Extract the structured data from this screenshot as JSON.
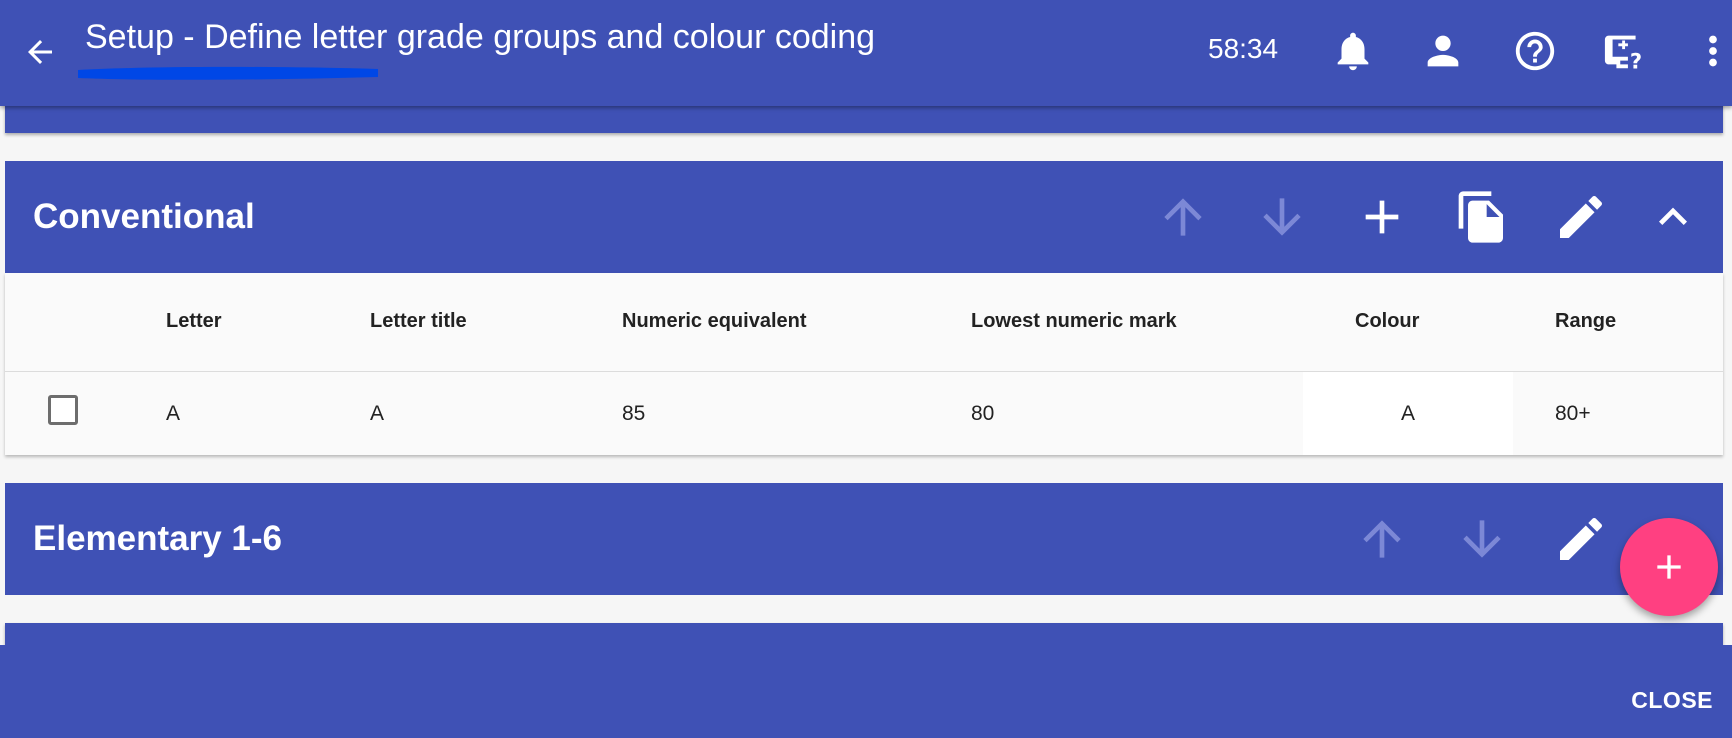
{
  "app_bar": {
    "title": "Setup - Define letter grade groups and colour coding",
    "timer": "58:34",
    "icons": [
      "back-arrow-icon",
      "bell-icon",
      "person-icon",
      "help-circle-icon",
      "monitor-help-icon",
      "more-vert-icon"
    ],
    "accent_color": "#3f51b5"
  },
  "groups": [
    {
      "name": "Conventional",
      "actions": [
        "move-up",
        "move-down",
        "add",
        "copy",
        "edit",
        "collapse"
      ],
      "table": {
        "columns": [
          "Letter",
          "Letter title",
          "Numeric equivalent",
          "Lowest numeric mark",
          "Colour",
          "Range"
        ],
        "rows": [
          {
            "letter": "A",
            "letter_title": "A",
            "numeric_equivalent": "85",
            "lowest_numeric_mark": "80",
            "colour": "A",
            "range": "80+"
          }
        ]
      }
    },
    {
      "name": "Elementary 1-6",
      "actions": [
        "move-up",
        "move-down",
        "edit"
      ]
    }
  ],
  "fab": {
    "icon": "add-icon",
    "color": "#ff4081"
  },
  "footer": {
    "close_label": "CLOSE"
  }
}
